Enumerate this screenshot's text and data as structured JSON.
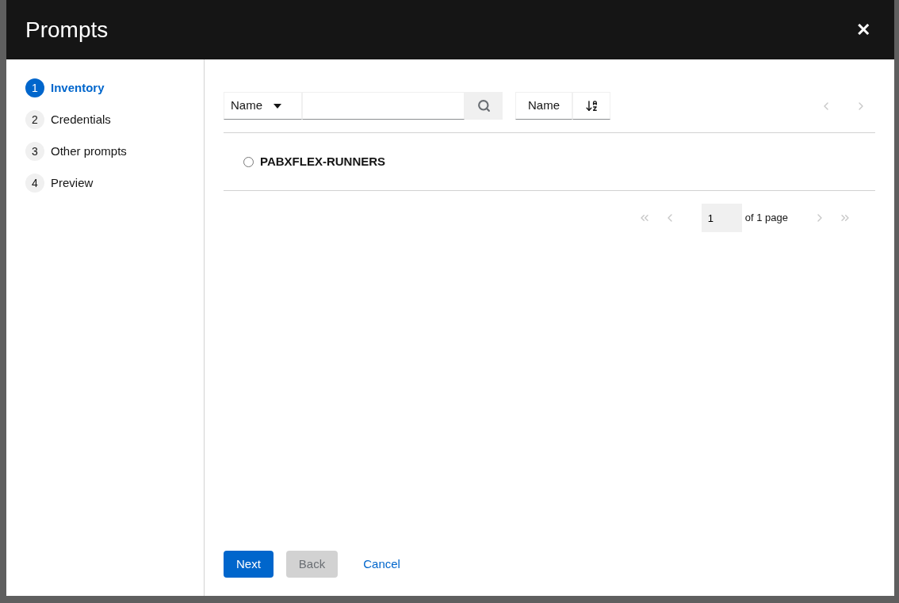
{
  "dialog": {
    "title": "Prompts",
    "close": "✕"
  },
  "steps": [
    {
      "number": "1",
      "label": "Inventory",
      "selected": true
    },
    {
      "number": "2",
      "label": "Credentials",
      "selected": false
    },
    {
      "number": "3",
      "label": "Other prompts",
      "selected": false
    },
    {
      "number": "4",
      "label": "Preview",
      "selected": false
    }
  ],
  "toolbar": {
    "filter_field": "Name",
    "sort_field": "Name"
  },
  "rows": [
    {
      "label": "PABXFLEX-RUNNERS",
      "selected": false
    }
  ],
  "pagination": {
    "page": "1",
    "of": "of 1 page"
  },
  "buttons": [
    {
      "label": "Next",
      "kind": "primary",
      "disabled": false
    },
    {
      "label": "Back",
      "kind": "secondary",
      "disabled": true
    },
    {
      "label": "Cancel",
      "kind": "link",
      "disabled": false
    }
  ]
}
